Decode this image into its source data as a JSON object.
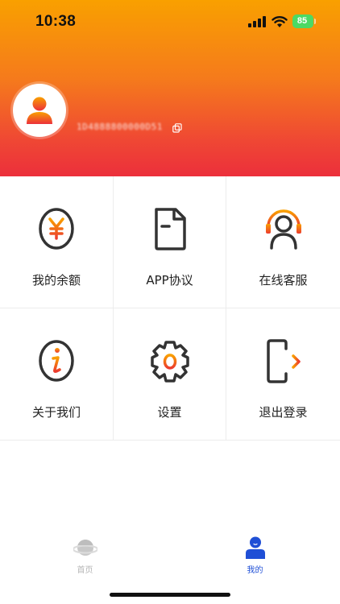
{
  "status_bar": {
    "time": "10:38",
    "battery_level": "85",
    "battery_color": "#4cd964"
  },
  "header": {
    "gradient_colors": [
      "#f9a000",
      "#ec2f3b"
    ],
    "avatar_icon": "user-avatar-icon",
    "account_id": "1D4888800000D51",
    "copy_icon": "copy-icon"
  },
  "menu": {
    "items": [
      {
        "label": "我的余额",
        "icon": "yuan-coin-icon"
      },
      {
        "label": "APP协议",
        "icon": "document-icon"
      },
      {
        "label": "在线客服",
        "icon": "headset-agent-icon"
      },
      {
        "label": "关于我们",
        "icon": "info-icon"
      },
      {
        "label": "设置",
        "icon": "gear-icon"
      },
      {
        "label": "退出登录",
        "icon": "logout-icon"
      }
    ]
  },
  "tabbar": {
    "tabs": [
      {
        "label": "首页",
        "icon": "planet-icon",
        "active": false
      },
      {
        "label": "我的",
        "icon": "user-icon",
        "active": true
      }
    ],
    "active_color": "#1f4fd6",
    "inactive_color": "#b5b5b5"
  }
}
